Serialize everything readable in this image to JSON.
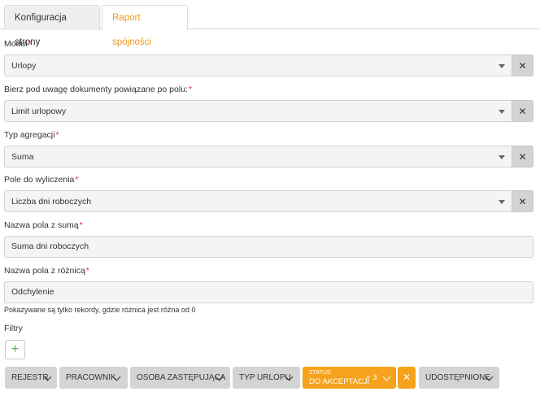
{
  "tabs": [
    {
      "label": "Konfiguracja strony",
      "active": false
    },
    {
      "label": "Raport spójności",
      "active": true
    }
  ],
  "form": {
    "required_marker": "*",
    "clear_symbol": "✕",
    "modul": {
      "label": "Moduł",
      "value": "Urlopy"
    },
    "powiazane": {
      "label": "Bierz pod uwagę dokumenty powiązane po polu:",
      "value": "Limit urlopowy"
    },
    "agregacja": {
      "label": "Typ agregacji",
      "value": "Suma"
    },
    "pole": {
      "label": "Pole do wyliczenia",
      "value": "Liczba dni roboczych"
    },
    "nazwa_suma": {
      "label": "Nazwa pola z sumą",
      "value": "Suma dni roboczych"
    },
    "nazwa_roznica": {
      "label": "Nazwa pola z różnicą",
      "value": "Odchylenie"
    },
    "hint": "Pokazywane są tylko rekordy, gdzie różnica jest różna od 0"
  },
  "filters": {
    "label": "Filtry",
    "add_symbol": "+",
    "chips": [
      {
        "label": "REJESTR"
      },
      {
        "label": "PRACOWNIK"
      },
      {
        "label": "OSOBA ZASTĘPUJĄCA"
      },
      {
        "label": "TYP URLOPU"
      },
      {
        "label": "STATUS",
        "value": "DO AKCEPTACJI",
        "count": "+ 3",
        "active": true
      },
      {
        "label": "UDOSTĘPNIONE"
      }
    ],
    "clear_symbol": "✕"
  },
  "colors": {
    "accent": "#f0961c",
    "chip_active": "#f6a21c",
    "required": "#e0262c",
    "add": "#4caf50"
  }
}
